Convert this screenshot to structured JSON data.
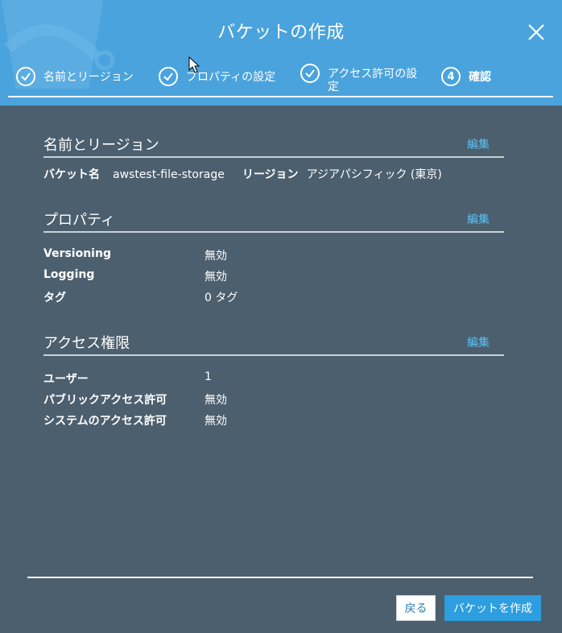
{
  "modal": {
    "title": "バケットの作成"
  },
  "steps": [
    {
      "label": "名前とリージョン",
      "state": "done"
    },
    {
      "label": "プロパティの設定",
      "state": "done"
    },
    {
      "label": "アクセス許可の設定",
      "state": "done"
    },
    {
      "number": "4",
      "label": "確認",
      "state": "current"
    }
  ],
  "sections": {
    "name_region": {
      "title": "名前とリージョン",
      "edit_label": "編集",
      "bucket_name_label": "バケット名",
      "bucket_name_value": "awstest-file-storage",
      "region_label": "リージョン",
      "region_value": "アジアパシフィック (東京)"
    },
    "properties": {
      "title": "プロパティ",
      "edit_label": "編集",
      "rows": [
        {
          "key": "Versioning",
          "value": "無効"
        },
        {
          "key": "Logging",
          "value": "無効"
        },
        {
          "key": "タグ",
          "value": "0 タグ"
        }
      ]
    },
    "access": {
      "title": "アクセス権限",
      "edit_label": "編集",
      "rows": [
        {
          "key": "ユーザー",
          "value": "1"
        },
        {
          "key": "パブリックアクセス許可",
          "value": "無効"
        },
        {
          "key": "システムのアクセス許可",
          "value": "無効"
        }
      ]
    }
  },
  "footer": {
    "back_label": "戻る",
    "create_label": "バケットを作成"
  },
  "colors": {
    "header": "#4aa3dc",
    "body": "#4c5f6e",
    "link": "#5bc0f2",
    "primary": "#2d9ee0"
  }
}
